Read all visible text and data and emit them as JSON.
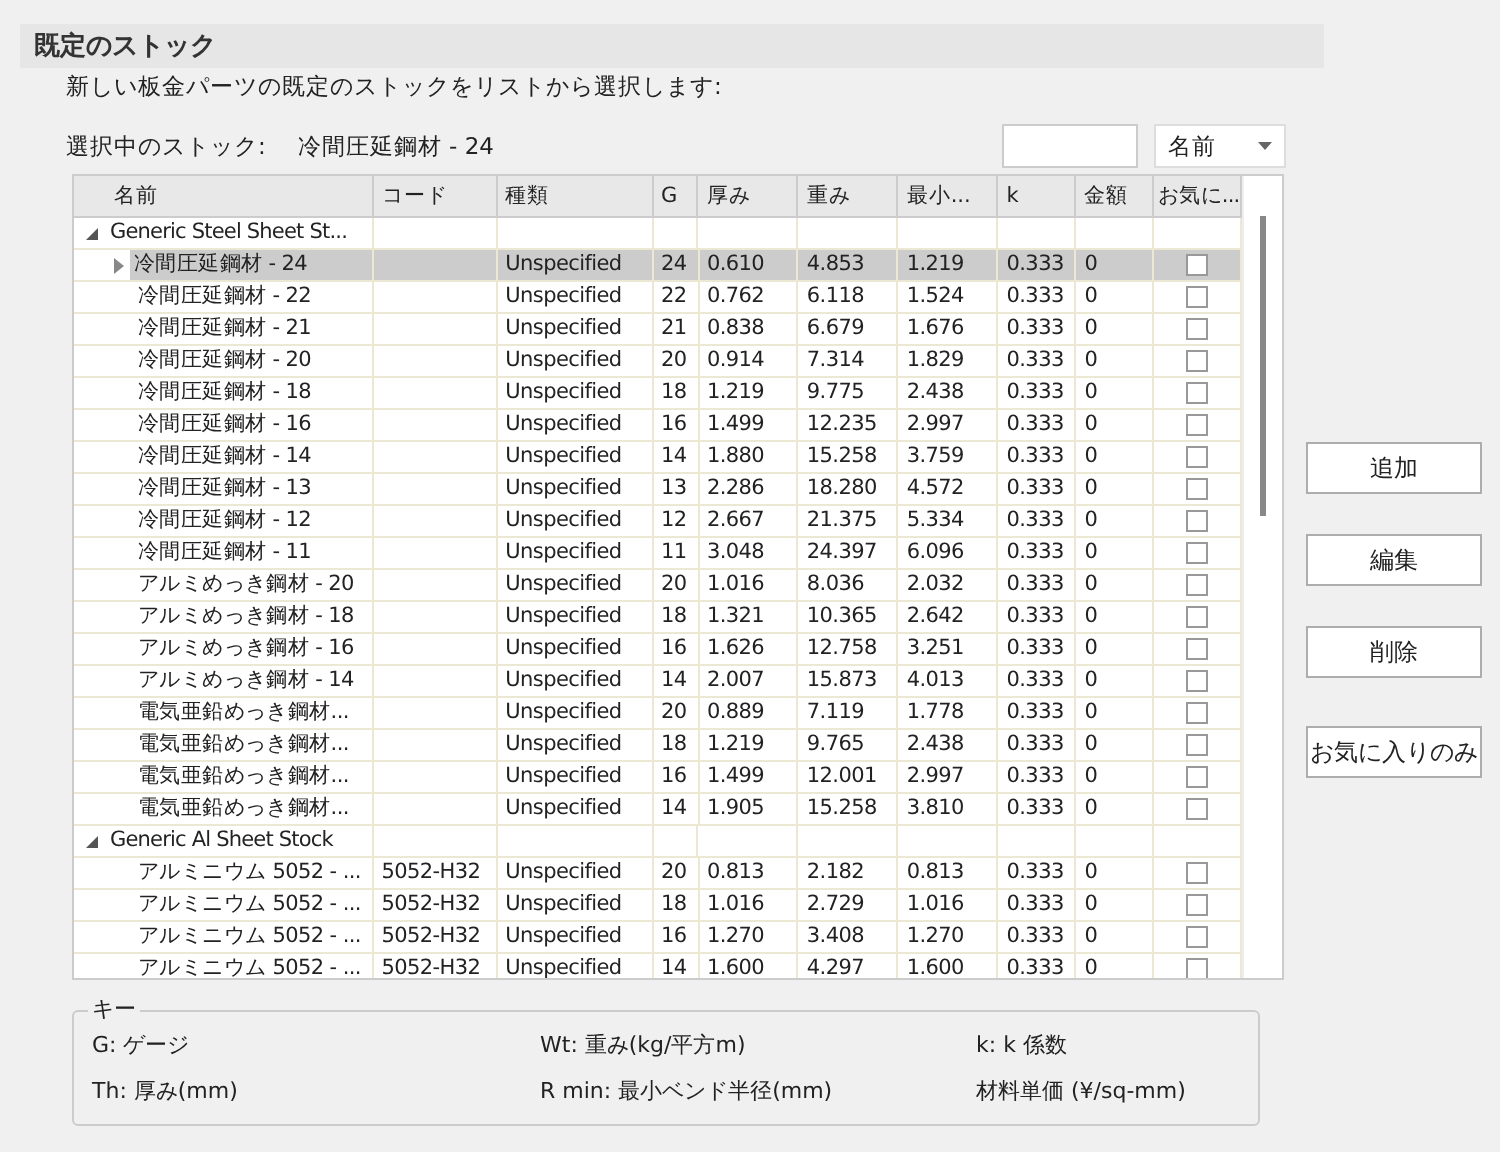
{
  "section_title": "既定のストック",
  "description": "新しい板金パーツの既定のストックをリストから選択します:",
  "current_stock": {
    "label": "選択中のストック:",
    "value": "冷間圧延鋼材 - 24"
  },
  "sort_dropdown": {
    "value": "名前"
  },
  "table": {
    "columns": [
      "名前",
      "コード",
      "種類",
      "G",
      "厚み",
      "重み",
      "最小...",
      "k",
      "金額",
      "お気に..."
    ],
    "groups": [
      {
        "name": "Generic Steel Sheet St...",
        "expanded": true,
        "rows": [
          {
            "name": "冷間圧延鋼材 - 24",
            "code": "",
            "type": "Unspecified",
            "g": "24",
            "th": "0.610",
            "wt": "4.853",
            "rmin": "1.219",
            "k": "0.333",
            "price": "0",
            "favorite": false,
            "selected": true
          },
          {
            "name": "冷間圧延鋼材 - 22",
            "code": "",
            "type": "Unspecified",
            "g": "22",
            "th": "0.762",
            "wt": "6.118",
            "rmin": "1.524",
            "k": "0.333",
            "price": "0",
            "favorite": false,
            "selected": false
          },
          {
            "name": "冷間圧延鋼材 - 21",
            "code": "",
            "type": "Unspecified",
            "g": "21",
            "th": "0.838",
            "wt": "6.679",
            "rmin": "1.676",
            "k": "0.333",
            "price": "0",
            "favorite": false,
            "selected": false
          },
          {
            "name": "冷間圧延鋼材 - 20",
            "code": "",
            "type": "Unspecified",
            "g": "20",
            "th": "0.914",
            "wt": "7.314",
            "rmin": "1.829",
            "k": "0.333",
            "price": "0",
            "favorite": false,
            "selected": false
          },
          {
            "name": "冷間圧延鋼材 - 18",
            "code": "",
            "type": "Unspecified",
            "g": "18",
            "th": "1.219",
            "wt": "9.775",
            "rmin": "2.438",
            "k": "0.333",
            "price": "0",
            "favorite": false,
            "selected": false
          },
          {
            "name": "冷間圧延鋼材 - 16",
            "code": "",
            "type": "Unspecified",
            "g": "16",
            "th": "1.499",
            "wt": "12.235",
            "rmin": "2.997",
            "k": "0.333",
            "price": "0",
            "favorite": false,
            "selected": false
          },
          {
            "name": "冷間圧延鋼材 - 14",
            "code": "",
            "type": "Unspecified",
            "g": "14",
            "th": "1.880",
            "wt": "15.258",
            "rmin": "3.759",
            "k": "0.333",
            "price": "0",
            "favorite": false,
            "selected": false
          },
          {
            "name": "冷間圧延鋼材 - 13",
            "code": "",
            "type": "Unspecified",
            "g": "13",
            "th": "2.286",
            "wt": "18.280",
            "rmin": "4.572",
            "k": "0.333",
            "price": "0",
            "favorite": false,
            "selected": false
          },
          {
            "name": "冷間圧延鋼材 - 12",
            "code": "",
            "type": "Unspecified",
            "g": "12",
            "th": "2.667",
            "wt": "21.375",
            "rmin": "5.334",
            "k": "0.333",
            "price": "0",
            "favorite": false,
            "selected": false
          },
          {
            "name": "冷間圧延鋼材 - 11",
            "code": "",
            "type": "Unspecified",
            "g": "11",
            "th": "3.048",
            "wt": "24.397",
            "rmin": "6.096",
            "k": "0.333",
            "price": "0",
            "favorite": false,
            "selected": false
          },
          {
            "name": "アルミめっき鋼材 - 20",
            "code": "",
            "type": "Unspecified",
            "g": "20",
            "th": "1.016",
            "wt": "8.036",
            "rmin": "2.032",
            "k": "0.333",
            "price": "0",
            "favorite": false,
            "selected": false
          },
          {
            "name": "アルミめっき鋼材 - 18",
            "code": "",
            "type": "Unspecified",
            "g": "18",
            "th": "1.321",
            "wt": "10.365",
            "rmin": "2.642",
            "k": "0.333",
            "price": "0",
            "favorite": false,
            "selected": false
          },
          {
            "name": "アルミめっき鋼材 - 16",
            "code": "",
            "type": "Unspecified",
            "g": "16",
            "th": "1.626",
            "wt": "12.758",
            "rmin": "3.251",
            "k": "0.333",
            "price": "0",
            "favorite": false,
            "selected": false
          },
          {
            "name": "アルミめっき鋼材 - 14",
            "code": "",
            "type": "Unspecified",
            "g": "14",
            "th": "2.007",
            "wt": "15.873",
            "rmin": "4.013",
            "k": "0.333",
            "price": "0",
            "favorite": false,
            "selected": false
          },
          {
            "name": "電気亜鉛めっき鋼材...",
            "code": "",
            "type": "Unspecified",
            "g": "20",
            "th": "0.889",
            "wt": "7.119",
            "rmin": "1.778",
            "k": "0.333",
            "price": "0",
            "favorite": false,
            "selected": false
          },
          {
            "name": "電気亜鉛めっき鋼材...",
            "code": "",
            "type": "Unspecified",
            "g": "18",
            "th": "1.219",
            "wt": "9.765",
            "rmin": "2.438",
            "k": "0.333",
            "price": "0",
            "favorite": false,
            "selected": false
          },
          {
            "name": "電気亜鉛めっき鋼材...",
            "code": "",
            "type": "Unspecified",
            "g": "16",
            "th": "1.499",
            "wt": "12.001",
            "rmin": "2.997",
            "k": "0.333",
            "price": "0",
            "favorite": false,
            "selected": false
          },
          {
            "name": "電気亜鉛めっき鋼材...",
            "code": "",
            "type": "Unspecified",
            "g": "14",
            "th": "1.905",
            "wt": "15.258",
            "rmin": "3.810",
            "k": "0.333",
            "price": "0",
            "favorite": false,
            "selected": false
          }
        ]
      },
      {
        "name": "Generic Al Sheet Stock",
        "expanded": true,
        "rows": [
          {
            "name": "アルミニウム 5052 - ...",
            "code": "5052-H32",
            "type": "Unspecified",
            "g": "20",
            "th": "0.813",
            "wt": "2.182",
            "rmin": "0.813",
            "k": "0.333",
            "price": "0",
            "favorite": false,
            "selected": false
          },
          {
            "name": "アルミニウム 5052 - ...",
            "code": "5052-H32",
            "type": "Unspecified",
            "g": "18",
            "th": "1.016",
            "wt": "2.729",
            "rmin": "1.016",
            "k": "0.333",
            "price": "0",
            "favorite": false,
            "selected": false
          },
          {
            "name": "アルミニウム 5052 - ...",
            "code": "5052-H32",
            "type": "Unspecified",
            "g": "16",
            "th": "1.270",
            "wt": "3.408",
            "rmin": "1.270",
            "k": "0.333",
            "price": "0",
            "favorite": false,
            "selected": false
          },
          {
            "name": "アルミニウム 5052 - ...",
            "code": "5052-H32",
            "type": "Unspecified",
            "g": "14",
            "th": "1.600",
            "wt": "4.297",
            "rmin": "1.600",
            "k": "0.333",
            "price": "0",
            "favorite": false,
            "selected": false
          }
        ]
      }
    ]
  },
  "buttons": [
    "追加",
    "編集",
    "削除",
    "お気に入りのみ"
  ],
  "key": {
    "title": "キー",
    "items": [
      "G: ゲージ",
      "Wt: 重み(kg/平方m)",
      "k: k 係数",
      "Th: 厚み(mm)",
      "R min: 最小ベンド半径(mm)",
      "材料単価 (¥/sq-mm)"
    ]
  }
}
